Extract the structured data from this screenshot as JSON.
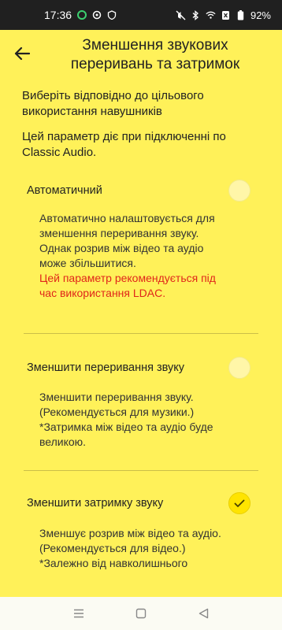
{
  "status_bar": {
    "time": "17:36",
    "battery": "92%"
  },
  "header": {
    "title": "Зменшення звукових переривань та затримок"
  },
  "intro": {
    "line1": "Виберіть відповідно до цільового використання навушників",
    "line2": "Цей параметр діє при підключенні по Classic Audio."
  },
  "options": [
    {
      "label": "Автоматичний",
      "selected": false,
      "desc_lines": [
        "Автоматично налаштовується для зменшення переривання звуку.",
        "Однак розрив між відео та аудіо може збільшитися."
      ],
      "warning": "Цей параметр рекомендується під час використання LDAC."
    },
    {
      "label": "Зменшити переривання звуку",
      "selected": false,
      "desc_lines": [
        "Зменшити переривання звуку.",
        "(Рекомендується для музики.)",
        "*Затримка між відео та аудіо буде великою."
      ]
    },
    {
      "label": "Зменшити затримку звуку",
      "selected": true,
      "desc_lines": [
        "Зменшує розрив між відео та аудіо.",
        "(Рекомендується для відео.)",
        "*Залежно від навколишнього"
      ]
    }
  ],
  "colors": {
    "background": "#fff159",
    "accent": "#ffe400",
    "warning": "#e0261a"
  }
}
